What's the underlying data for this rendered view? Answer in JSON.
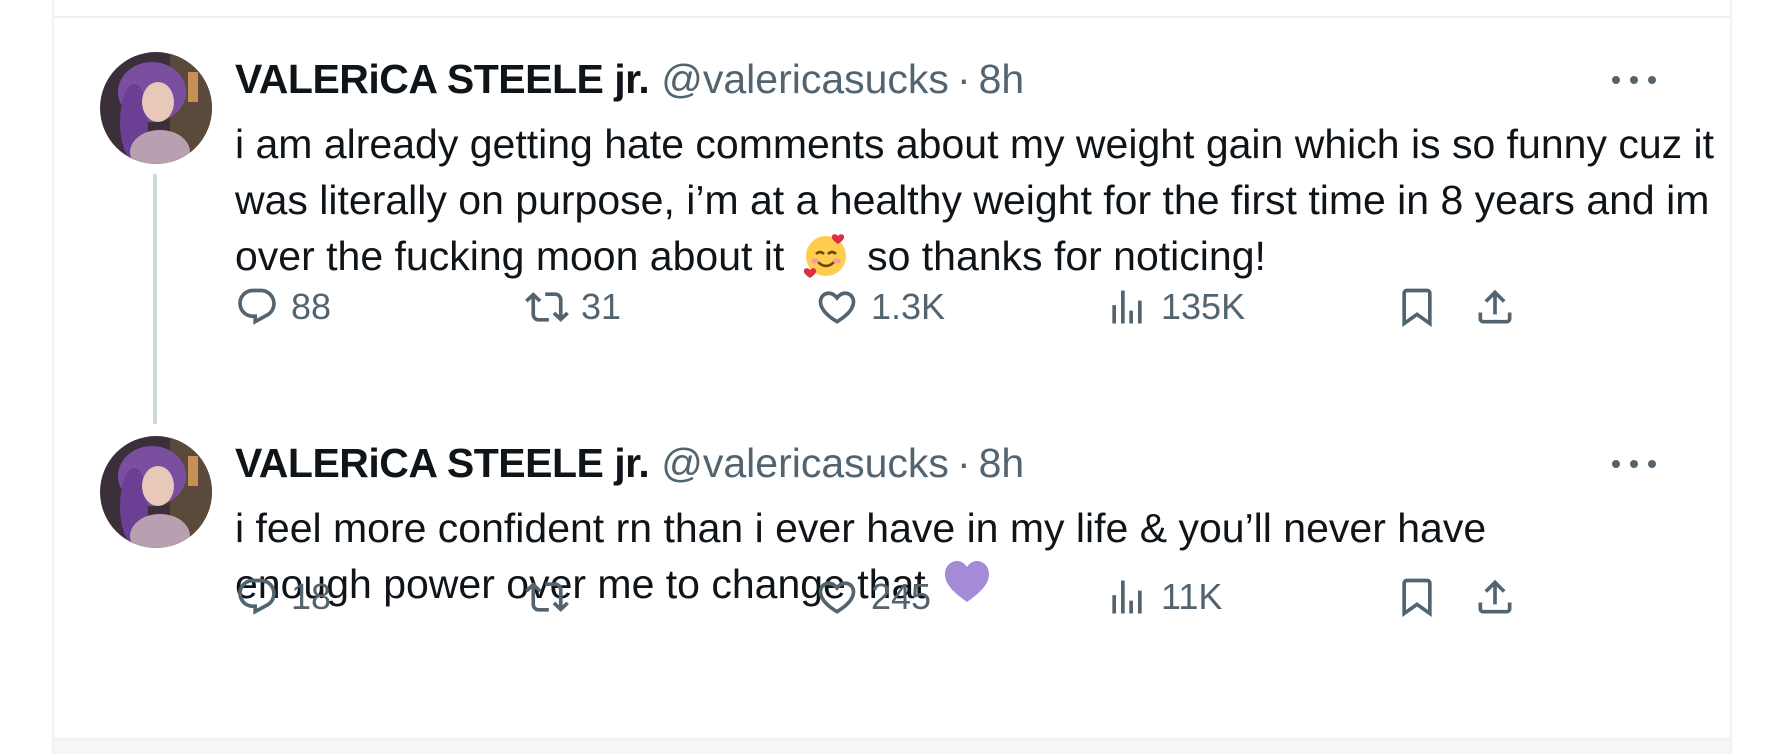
{
  "tweets": [
    {
      "display_name": "VALERiCA STEELE jr.",
      "handle": "@valericasucks",
      "separator": "·",
      "time": "8h",
      "text_before_emoji": "i am already getting hate comments about my weight gain which is so funny cuz it was literally on purpose, i’m at a healthy weight for the first time in 8 years and im over the fucking moon about it",
      "emoji": "smiling-face-with-hearts",
      "text_after_emoji": "so thanks for noticing!",
      "replies": "88",
      "retweets": "31",
      "likes": "1.3K",
      "views": "135K"
    },
    {
      "display_name": "VALERiCA STEELE jr.",
      "handle": "@valericasucks",
      "separator": "·",
      "time": "8h",
      "text_before_emoji": "i feel more confident rn than i ever have in my life & you’ll never have enough power over me to change that",
      "emoji": "purple-heart",
      "text_after_emoji": "",
      "replies": "18",
      "retweets": "",
      "likes": "245",
      "views": "11K"
    }
  ],
  "colors": {
    "text_primary": "#0f1419",
    "text_secondary": "#536471",
    "divider": "#eff3f4",
    "thread_line": "#cfd9de",
    "purple_heart": "#a48bd8"
  },
  "icons": [
    "reply-icon",
    "retweet-icon",
    "like-icon",
    "views-icon",
    "bookmark-icon",
    "share-icon",
    "more-icon"
  ]
}
